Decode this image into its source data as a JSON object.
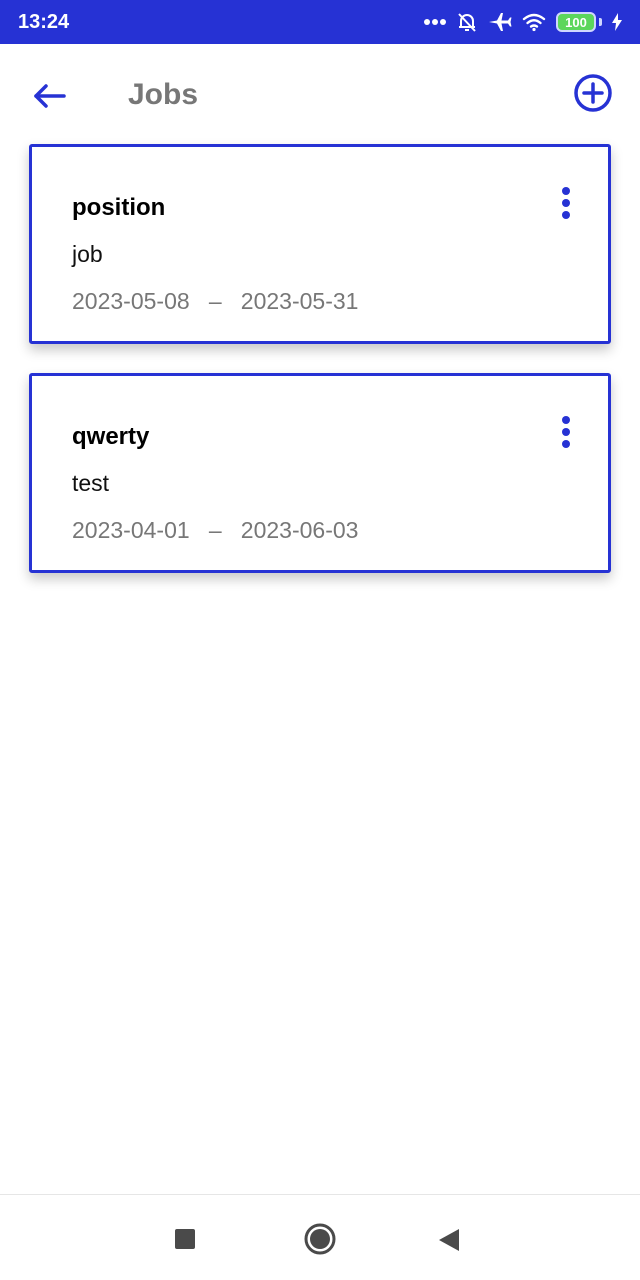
{
  "status_bar": {
    "time": "13:24",
    "battery": "100",
    "icons": [
      "more-dots-icon",
      "alarm-off-icon",
      "airplane-icon",
      "wifi-icon",
      "battery-icon",
      "charging-bolt-icon"
    ]
  },
  "app_bar": {
    "title": "Jobs",
    "back_icon": "arrow-left-icon",
    "add_icon": "add-circle-icon"
  },
  "jobs": [
    {
      "title": "position",
      "subtitle": "job",
      "start": "2023-05-08",
      "end": "2023-05-31",
      "separator": "–"
    },
    {
      "title": "qwerty",
      "subtitle": "test",
      "start": "2023-04-01",
      "end": "2023-06-03",
      "separator": "–"
    }
  ],
  "nav_bar": {
    "icons": [
      "square-recents-icon",
      "circle-home-icon",
      "triangle-back-icon"
    ]
  },
  "colors": {
    "accent": "#2632d4",
    "title_gray": "#777777",
    "battery_green": "#5cd65c"
  }
}
